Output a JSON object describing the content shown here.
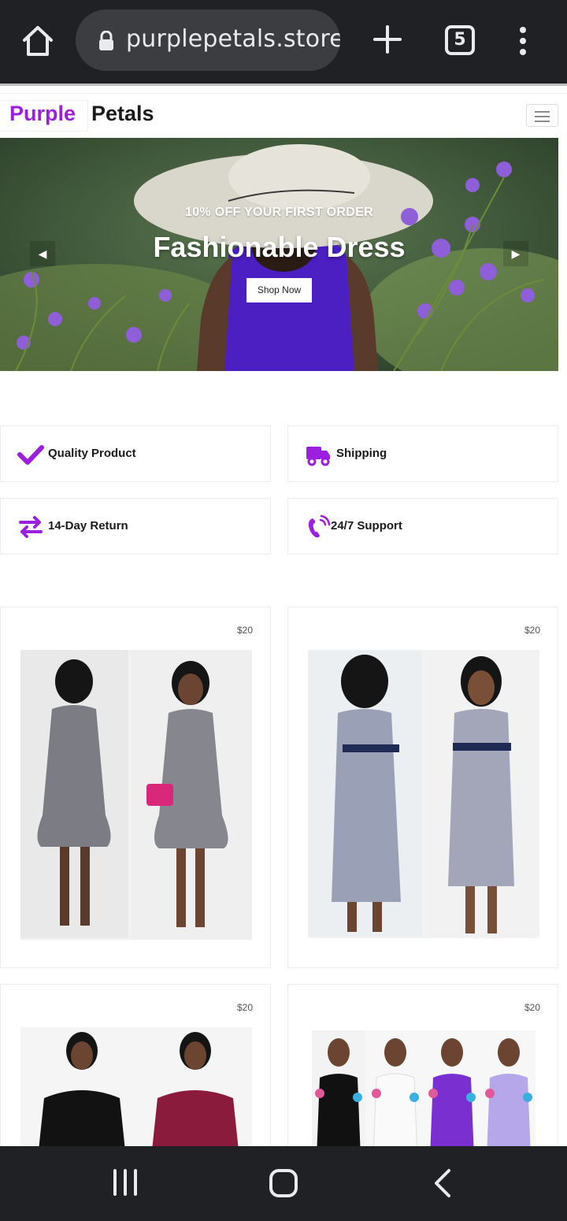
{
  "browser": {
    "url": "purplepetals.store",
    "tab_count": "5"
  },
  "site": {
    "brand_first": "Purple",
    "brand_second": "Petals"
  },
  "hero": {
    "subtitle": "10% OFF YOUR FIRST ORDER",
    "title": "Fashionable Dress",
    "button": "Shop Now"
  },
  "features": [
    {
      "label": "Quality Product",
      "icon": "check-icon"
    },
    {
      "label": "Shipping",
      "icon": "truck-icon"
    },
    {
      "label": "14-Day Return",
      "icon": "exchange-icon"
    },
    {
      "label": "24/7 Support",
      "icon": "phone-icon"
    }
  ],
  "products": [
    {
      "price": "$20"
    },
    {
      "price": "$20"
    },
    {
      "price": "$20"
    },
    {
      "price": "$20"
    }
  ],
  "colors": {
    "accent": "#9c1fe0",
    "chrome": "#202124"
  }
}
